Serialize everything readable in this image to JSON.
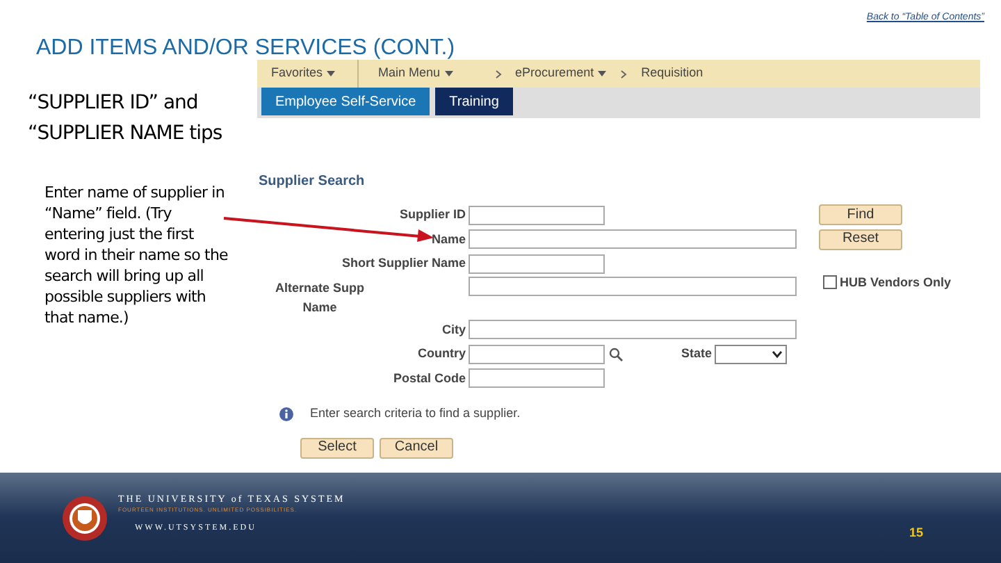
{
  "header_link": "Back to “Table of Contents”",
  "title": "ADD ITEMS AND/OR SERVICES (CONT.)",
  "tip_heading": "“SUPPLIER ID” and “SUPPLIER NAME tips",
  "tip_text": "Enter name of supplier in “Name” field. (Try entering just the first word in their name so the search will bring up all possible suppliers with that name.)",
  "screenshot": {
    "nav": [
      {
        "label": "Favorites",
        "kind": "menu",
        "dropdown": true
      },
      {
        "label": "Main Menu",
        "kind": "menu",
        "dropdown": true
      },
      {
        "label": "eProcurement",
        "kind": "crumb",
        "dropdown": true
      },
      {
        "label": "Requisition",
        "kind": "crumb",
        "dropdown": false
      }
    ],
    "tabs": [
      {
        "label": "Employee Self-Service",
        "selected": false
      },
      {
        "label": "Training",
        "selected": true
      }
    ],
    "title": "Supplier Search",
    "fields": [
      {
        "label": "Supplier ID",
        "kind": "short"
      },
      {
        "label": "Name",
        "kind": "long"
      },
      {
        "label": "Short Supplier Name",
        "kind": "short"
      },
      {
        "label": "Alternate Supp Name",
        "kind": "long",
        "wrap": true
      },
      {
        "label": "City",
        "kind": "long"
      },
      {
        "label": "Country",
        "kind": "short",
        "lookup": true
      },
      {
        "label": "Postal Code",
        "kind": "short"
      }
    ],
    "state_label": "State",
    "side_buttons": [
      "Find",
      "Reset"
    ],
    "checkbox": {
      "label": "HUB Vendors Only",
      "checked": false
    },
    "message": "Enter search criteria to find a supplier.",
    "buttons": [
      "Select",
      "Cancel"
    ]
  },
  "footer": {
    "university": "THE UNIVERSITY of TEXAS SYSTEM",
    "tagline": "FOURTEEN INSTITUTIONS. UNLIMITED POSSIBILITIES.",
    "url": "WWW.UTSYSTEM.EDU",
    "page": "15"
  }
}
